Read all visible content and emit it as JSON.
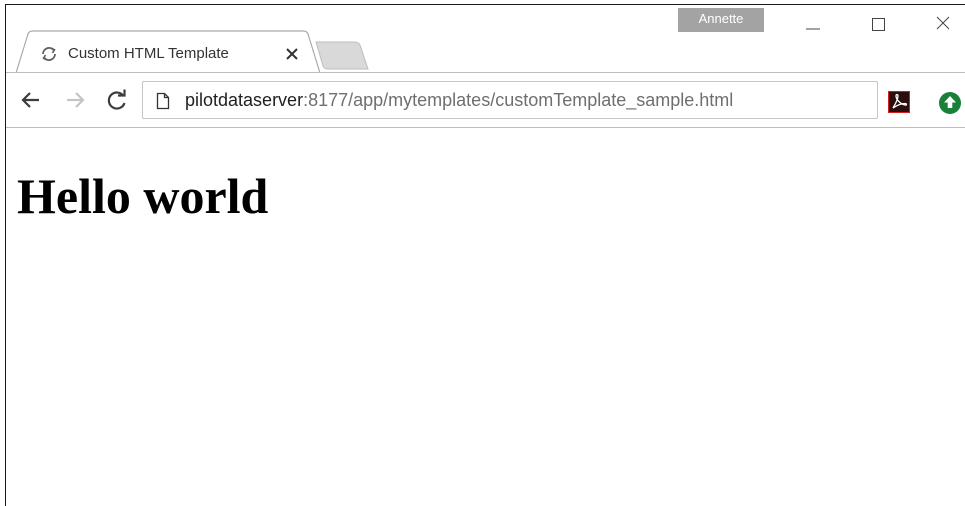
{
  "tab": {
    "title": "Custom HTML Template",
    "favicon": "loading-spinner-icon",
    "close": "close-icon"
  },
  "profile": {
    "name": "Annette"
  },
  "window_controls": {
    "minimize": "minimize-icon",
    "maximize": "maximize-icon",
    "close": "close-icon"
  },
  "toolbar": {
    "back": "arrow-left-icon",
    "forward": "arrow-right-icon",
    "reload": "reload-icon"
  },
  "address_bar": {
    "page_icon": "page-icon",
    "host": "pilotdataserver",
    "path": ":8177/app/mytemplates/customTemplate_sample.html"
  },
  "extensions": [
    {
      "name": "adobe-acrobat-icon",
      "color": "#d71e1e"
    },
    {
      "name": "upload-icon",
      "color": "#188038"
    }
  ],
  "page": {
    "heading": "Hello world"
  }
}
